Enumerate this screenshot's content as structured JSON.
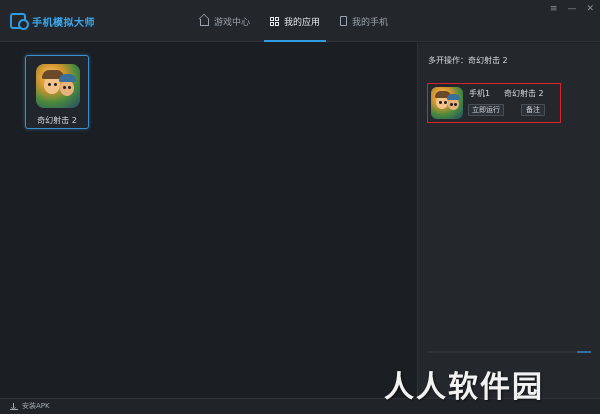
{
  "app": {
    "title": "手机模拟大师"
  },
  "nav": {
    "tabs": [
      {
        "label": "游戏中心",
        "icon": "home-icon",
        "active": false
      },
      {
        "label": "我的应用",
        "icon": "grid-icon",
        "active": true
      },
      {
        "label": "我的手机",
        "icon": "phone-icon",
        "active": false
      }
    ]
  },
  "window_controls": {
    "menu": "≡",
    "minimize": "—",
    "close": "✕"
  },
  "apps": [
    {
      "name": "奇幻射击 2",
      "icon": "game-icon"
    }
  ],
  "side_panel": {
    "header_prefix": "多开操作：",
    "header_game": "奇幻射击 2",
    "instances": [
      {
        "phone": "手机1",
        "game": "奇幻射击 2",
        "run_label": "立即运行",
        "note_label": "备注"
      }
    ]
  },
  "footer": {
    "install_label": "安装APK",
    "install_icon": "download-icon"
  },
  "watermark": "人人软件园",
  "colors": {
    "accent": "#2f9ce0",
    "highlight_border": "#d9222a",
    "background": "#1c1f23"
  }
}
